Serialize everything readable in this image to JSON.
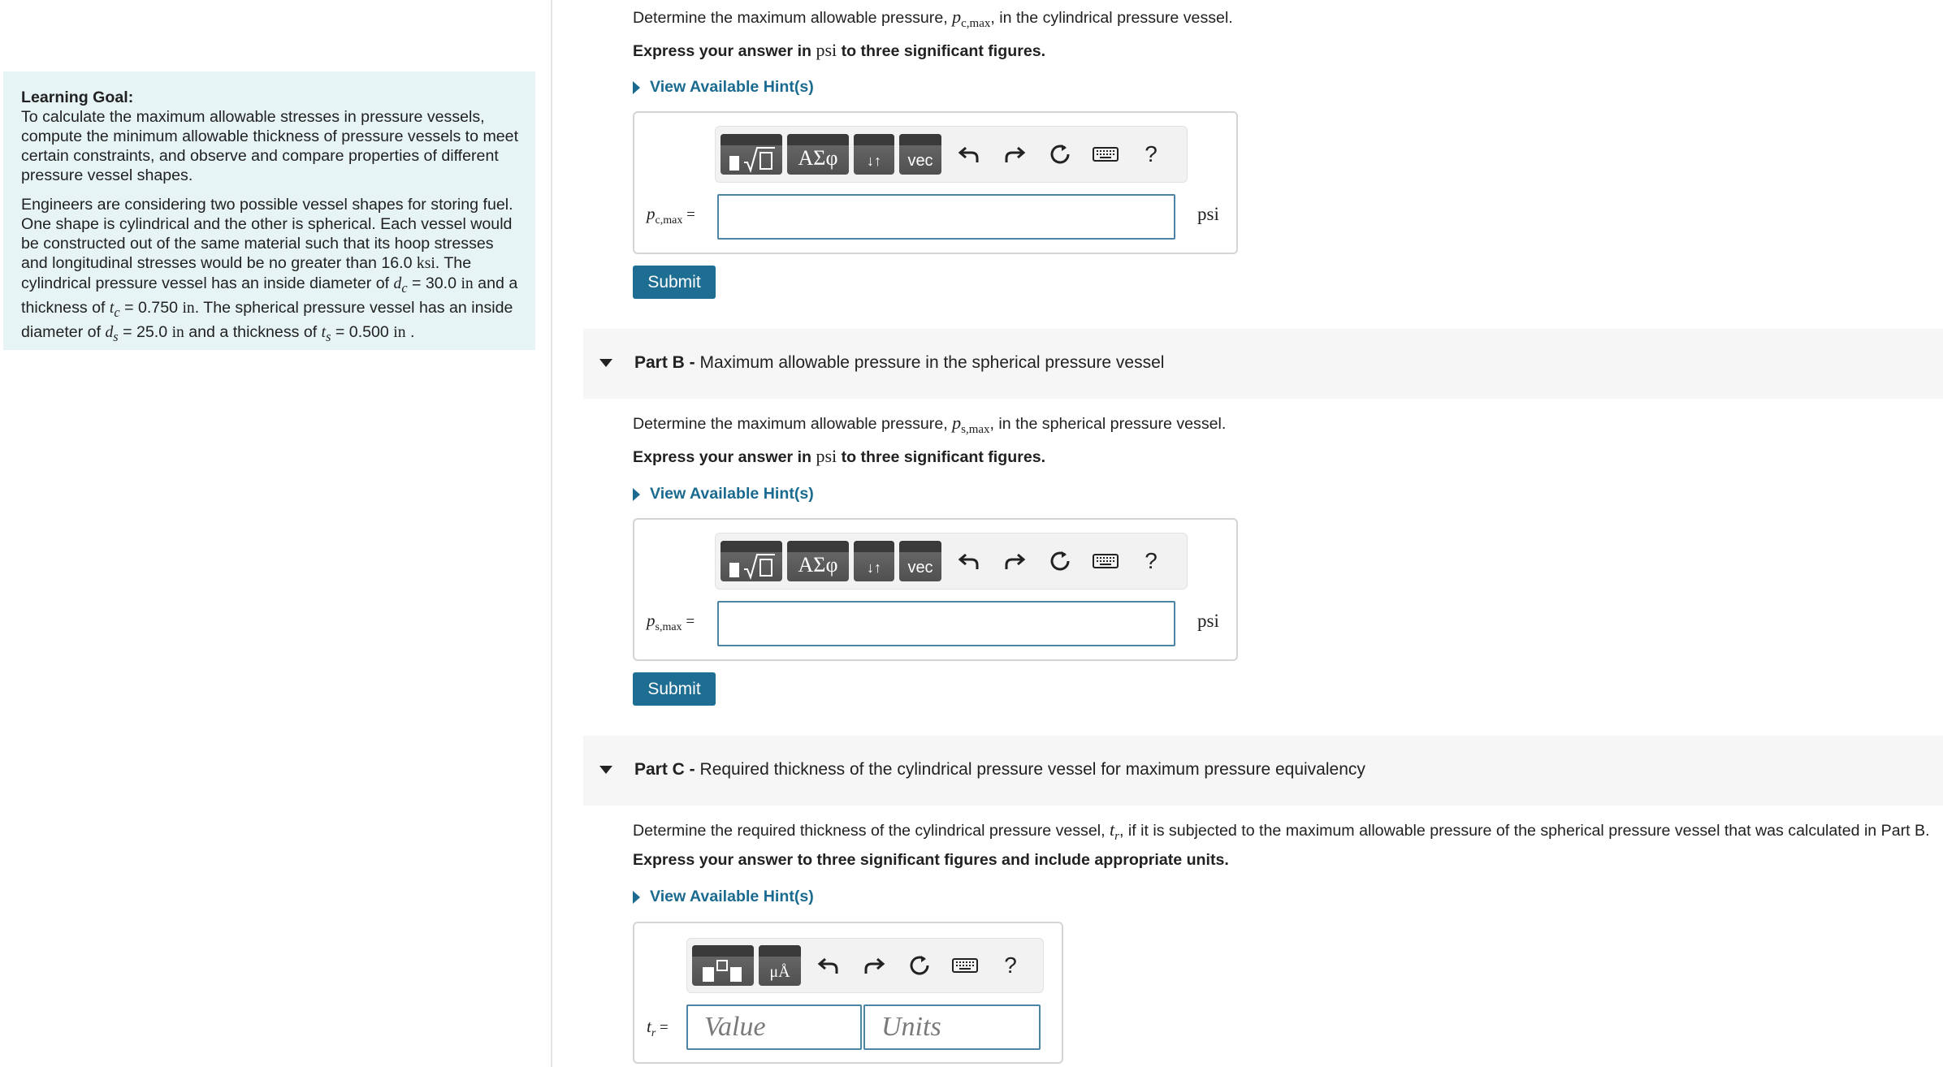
{
  "learning_goal": {
    "title": "Learning Goal:",
    "text": "To calculate the maximum allowable stresses in pressure vessels, compute the minimum allowable thickness of pressure vessels to meet certain constraints, and observe and compare properties of different pressure vessel shapes.",
    "scenario": {
      "p1": "Engineers are considering two possible vessel shapes for storing fuel. One shape is cylindrical and the other is spherical. Each vessel would be constructed out of the same material such that its hoop stresses and longitudinal stresses would be no greater than 16.0",
      "ksi": "ksi",
      "p2": ". The cylindrical pressure vessel has an inside diameter of",
      "dc_var": "d",
      "dc_sub": "c",
      "dc_val": " = 30.0 ",
      "in1": "in",
      "p3": " and a thickness of",
      "tc_var": "t",
      "tc_sub": "c",
      "tc_val": " = 0.750 ",
      "in2": "in",
      "p4": ". The spherical pressure vessel has an inside diameter of",
      "ds_var": "d",
      "ds_sub": "s",
      "ds_val": " = 25.0 ",
      "in3": "in",
      "p5": " and a thickness of",
      "ts_var": "t",
      "ts_sub": "s",
      "ts_val": " = 0.500 ",
      "in4": "in",
      "p6": " ."
    }
  },
  "part_a": {
    "question_pre": "Determine the maximum allowable pressure, ",
    "question_var": "p",
    "question_sub": "c,max",
    "question_post": ", in the cylindrical pressure vessel.",
    "express_pre": "Express your answer in ",
    "express_unit": "psi",
    "express_post": " to three significant figures.",
    "hint": "View Available Hint(s)",
    "eq_var": "p",
    "eq_sub": "c,max",
    "eq_eq": " =",
    "unit": "psi",
    "submit": "Submit"
  },
  "part_b": {
    "head_bold": "Part B -",
    "head_text": " Maximum allowable pressure in the spherical pressure vessel",
    "question_pre": "Determine the maximum allowable pressure, ",
    "question_var": "p",
    "question_sub": "s,max",
    "question_post": ", in the spherical pressure vessel.",
    "express_pre": "Express your answer in ",
    "express_unit": "psi",
    "express_post": " to three significant figures.",
    "hint": "View Available Hint(s)",
    "eq_var": "p",
    "eq_sub": "s,max",
    "eq_eq": " =",
    "unit": "psi",
    "submit": "Submit"
  },
  "part_c": {
    "head_bold": "Part C -",
    "head_text": " Required thickness of the cylindrical pressure vessel for maximum pressure equivalency",
    "question_pre": "Determine the required thickness of the cylindrical pressure vessel, ",
    "question_var": "t",
    "question_sub": "r",
    "question_post": ", if it is subjected to the maximum allowable pressure of the spherical pressure vessel that was calculated in Part B.",
    "express": "Express your answer to three significant figures and include appropriate units.",
    "hint": "View Available Hint(s)",
    "eq_var": "t",
    "eq_sub": "r",
    "eq_eq": " =",
    "value_placeholder": "Value",
    "units_placeholder": "Units"
  },
  "toolbar": {
    "greek": "ΑΣφ",
    "vec": "vec",
    "help": "?",
    "units_icon": "μÅ"
  },
  "icons": [
    "templates-icon",
    "greek-letters-icon",
    "subscript-superscript-icon",
    "vector-icon",
    "undo-icon",
    "redo-icon",
    "reset-icon",
    "keyboard-icon",
    "help-icon",
    "units-icon",
    "hint-caret-icon",
    "collapse-caret-icon"
  ],
  "colors": {
    "accent": "#1e6d92",
    "hint_link": "#1a6b8f",
    "goal_bg": "#e7f4f5",
    "input_border": "#4b84a5"
  }
}
